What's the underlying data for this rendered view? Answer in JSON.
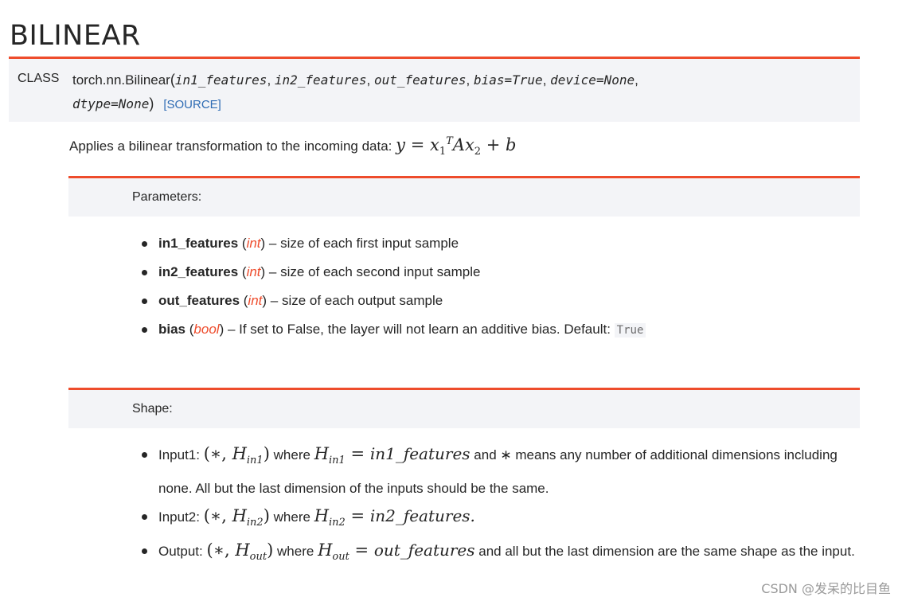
{
  "page_title": "BILINEAR",
  "signature": {
    "class_label": "CLASS",
    "name": "torch.nn.Bilinear",
    "open_paren": "(",
    "close_paren": ")",
    "params_line1": [
      "in1_features",
      "in2_features",
      "out_features",
      "bias=True",
      "device=None"
    ],
    "params_line2": [
      "dtype=None"
    ],
    "source_link": "[SOURCE]"
  },
  "summary": {
    "text": "Applies a bilinear transformation to the incoming data:",
    "formula": "y = x1T A x2 + b"
  },
  "parameters": {
    "heading": "Parameters:",
    "items": [
      {
        "name": "in1_features",
        "type": "int",
        "desc": "size of each first input sample"
      },
      {
        "name": "in2_features",
        "type": "int",
        "desc": "size of each second input sample"
      },
      {
        "name": "out_features",
        "type": "int",
        "desc": "size of each output sample"
      },
      {
        "name": "bias",
        "type": "bool",
        "desc": "If set to False, the layer will not learn an additive bias. Default:",
        "default": "True"
      }
    ]
  },
  "shape": {
    "heading": "Shape:",
    "input1": {
      "label": "Input1:",
      "math_shape": "(∗, Hin1)",
      "where": "where",
      "eq": "Hin1 = in1_features",
      "and": "and",
      "star": "∗",
      "rest": "means any number of additional dimensions including none. All but the last dimension of the inputs should be the same."
    },
    "input2": {
      "label": "Input2:",
      "math_shape": "(∗, Hin2)",
      "where": "where",
      "eq": "Hin2 = in2_features."
    },
    "output": {
      "label": "Output:",
      "math_shape": "(∗, Hout)",
      "where": "where",
      "eq": "Hout = out_features",
      "rest": "and all but the last dimension are the same shape as the input."
    }
  },
  "watermark": "CSDN @发呆的比目鱼"
}
